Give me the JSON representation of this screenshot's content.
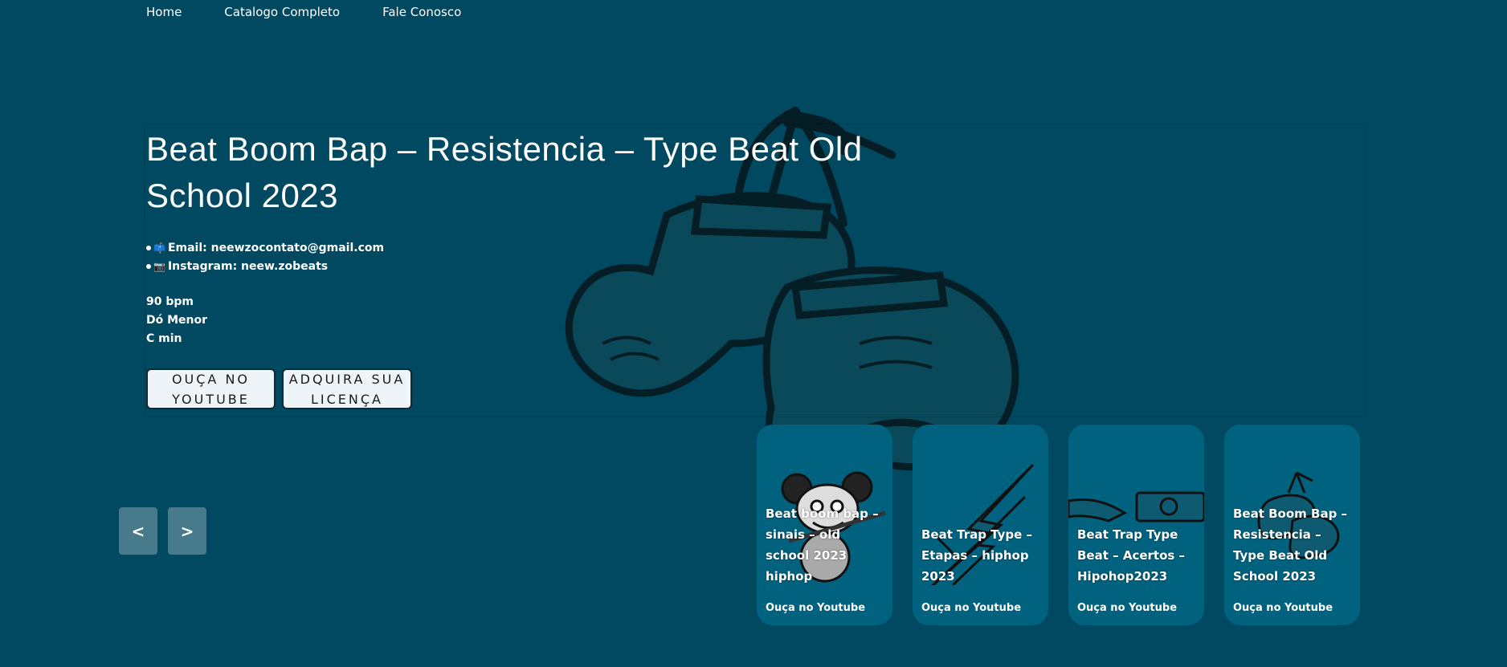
{
  "nav": {
    "items": [
      "Home",
      "Catalogo Completo",
      "Fale Conosco"
    ]
  },
  "hero": {
    "title": "Beat Boom Bap – Resistencia – Type Beat Old School 2023",
    "contact": [
      {
        "icon": "mailbox-icon",
        "glyph": "📫",
        "text": "Email: neewzocontato@gmail.com"
      },
      {
        "icon": "camera-icon",
        "glyph": "📷",
        "text": "Instagram: neew.zobeats"
      }
    ],
    "specs": [
      "90 bpm",
      "Dó Menor",
      "C min"
    ],
    "buttons": {
      "youtube": "OUÇA NO YOUTUBE",
      "license": "ADQUIRA SUA LICENÇA"
    }
  },
  "carousel": {
    "prev": "<",
    "next": ">",
    "cards": [
      {
        "title": "Beat boom bap – sinais – old school 2023 hiphop",
        "link": "Ouça no Youtube",
        "art": "mouse-character"
      },
      {
        "title": "Beat Trap Type – Etapas – hiphop 2023",
        "link": "Ouça no Youtube",
        "art": "lightning-bolt"
      },
      {
        "title": "Beat Trap Type Beat – Acertos – Hipohop2023",
        "link": "Ouça no Youtube",
        "art": "hands-money"
      },
      {
        "title": "Beat Boom Bap – Resistencia – Type Beat Old School 2023",
        "link": "Ouça no Youtube",
        "art": "boxing-gloves"
      }
    ]
  },
  "colors": {
    "background": "#004960",
    "card": "#00627f",
    "arrow": "#477a8a",
    "button": "#eef4f8"
  }
}
